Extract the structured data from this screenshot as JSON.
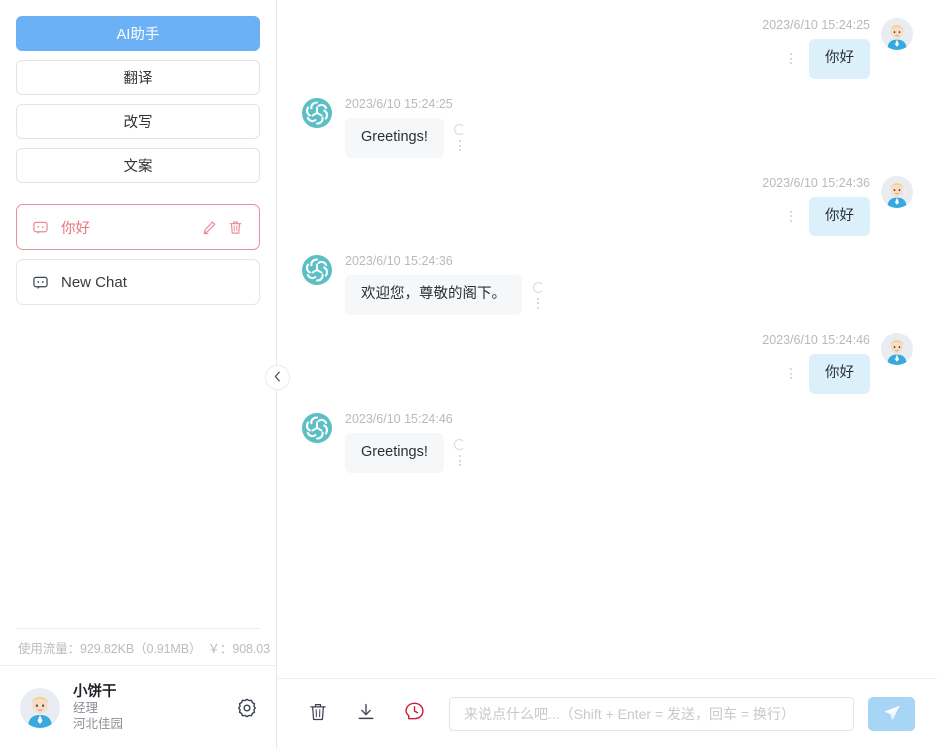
{
  "sidebar": {
    "modes": [
      {
        "label": "AI助手",
        "active": true
      },
      {
        "label": "翻译",
        "active": false
      },
      {
        "label": "改写",
        "active": false
      },
      {
        "label": "文案",
        "active": false
      }
    ],
    "chats": [
      {
        "label": "你好",
        "selected": true,
        "icon": "chat-bubble-icon",
        "actions": [
          "edit-icon",
          "delete-icon"
        ]
      },
      {
        "label": "New Chat",
        "selected": false,
        "icon": "chat-bubble-icon",
        "actions": []
      }
    ],
    "usage": "使用流量：929.82KB（0.91MB）　￥：908.03",
    "profile": {
      "name": "小饼干",
      "role": "经理",
      "org": "河北佳园",
      "settings_icon": "gear-icon"
    },
    "collapse_icon": "chevron-left-icon"
  },
  "chat": {
    "messages": [
      {
        "role": "user",
        "time": "2023/6/10 15:24:25",
        "text": "你好"
      },
      {
        "role": "bot",
        "time": "2023/6/10 15:24:25",
        "text": "Greetings!"
      },
      {
        "role": "user",
        "time": "2023/6/10 15:24:36",
        "text": "你好"
      },
      {
        "role": "bot",
        "time": "2023/6/10 15:24:36",
        "text": "欢迎您，尊敬的阁下。"
      },
      {
        "role": "user",
        "time": "2023/6/10 15:24:46",
        "text": "你好"
      },
      {
        "role": "bot",
        "time": "2023/6/10 15:24:46",
        "text": "Greetings!"
      }
    ]
  },
  "composer": {
    "tools": [
      {
        "name": "clear-chat-button",
        "icon": "trash-icon"
      },
      {
        "name": "export-chat-button",
        "icon": "download-icon"
      },
      {
        "name": "chat-history-button",
        "icon": "history-clock-icon"
      }
    ],
    "input_value": "",
    "input_placeholder": "来说点什么吧...（Shift + Enter = 发送，回车 = 换行）",
    "send_icon": "send-plane-icon"
  },
  "colors": {
    "accent_blue": "#6cb0f5",
    "user_bubble": "#dcf0fb",
    "bot_bubble": "#f6f7f8",
    "selected_chat_red": "#e8747f",
    "history_icon_red": "#d01c33",
    "bot_avatar_teal": "#5bbfc4",
    "send_button_blue": "#a7d5f5"
  }
}
